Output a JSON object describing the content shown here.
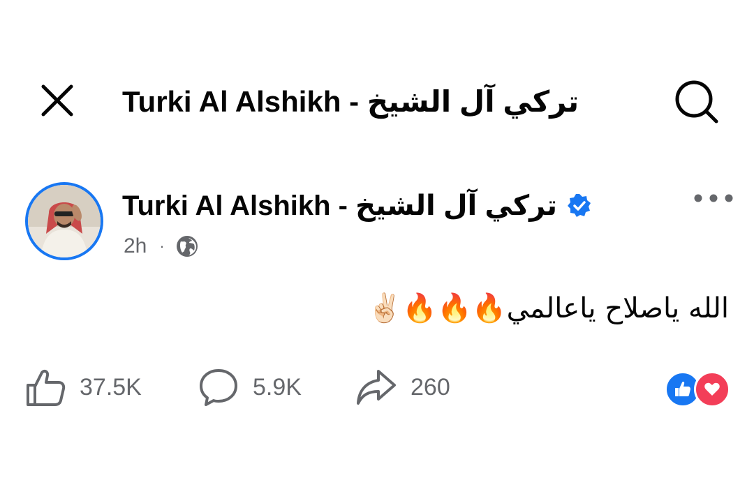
{
  "header": {
    "title": "Turki Al Alshikh - تركي آل الشيخ",
    "close_icon": "close-icon",
    "search_icon": "search-icon"
  },
  "post": {
    "author": "Turki Al Alshikh - تركي آل الشيخ",
    "verified": true,
    "time": "2h",
    "separator": "·",
    "audience_icon": "globe-icon",
    "more_icon": "more-options-icon",
    "text": "الله ياصلاح ياعالمي🔥🔥🔥✌🏻"
  },
  "actions": {
    "like_count": "37.5K",
    "comment_count": "5.9K",
    "share_count": "260"
  },
  "reactions": [
    "like",
    "love"
  ],
  "colors": {
    "accent": "#1877f2",
    "love": "#f33e58",
    "muted": "#65676b",
    "text": "#050505"
  }
}
